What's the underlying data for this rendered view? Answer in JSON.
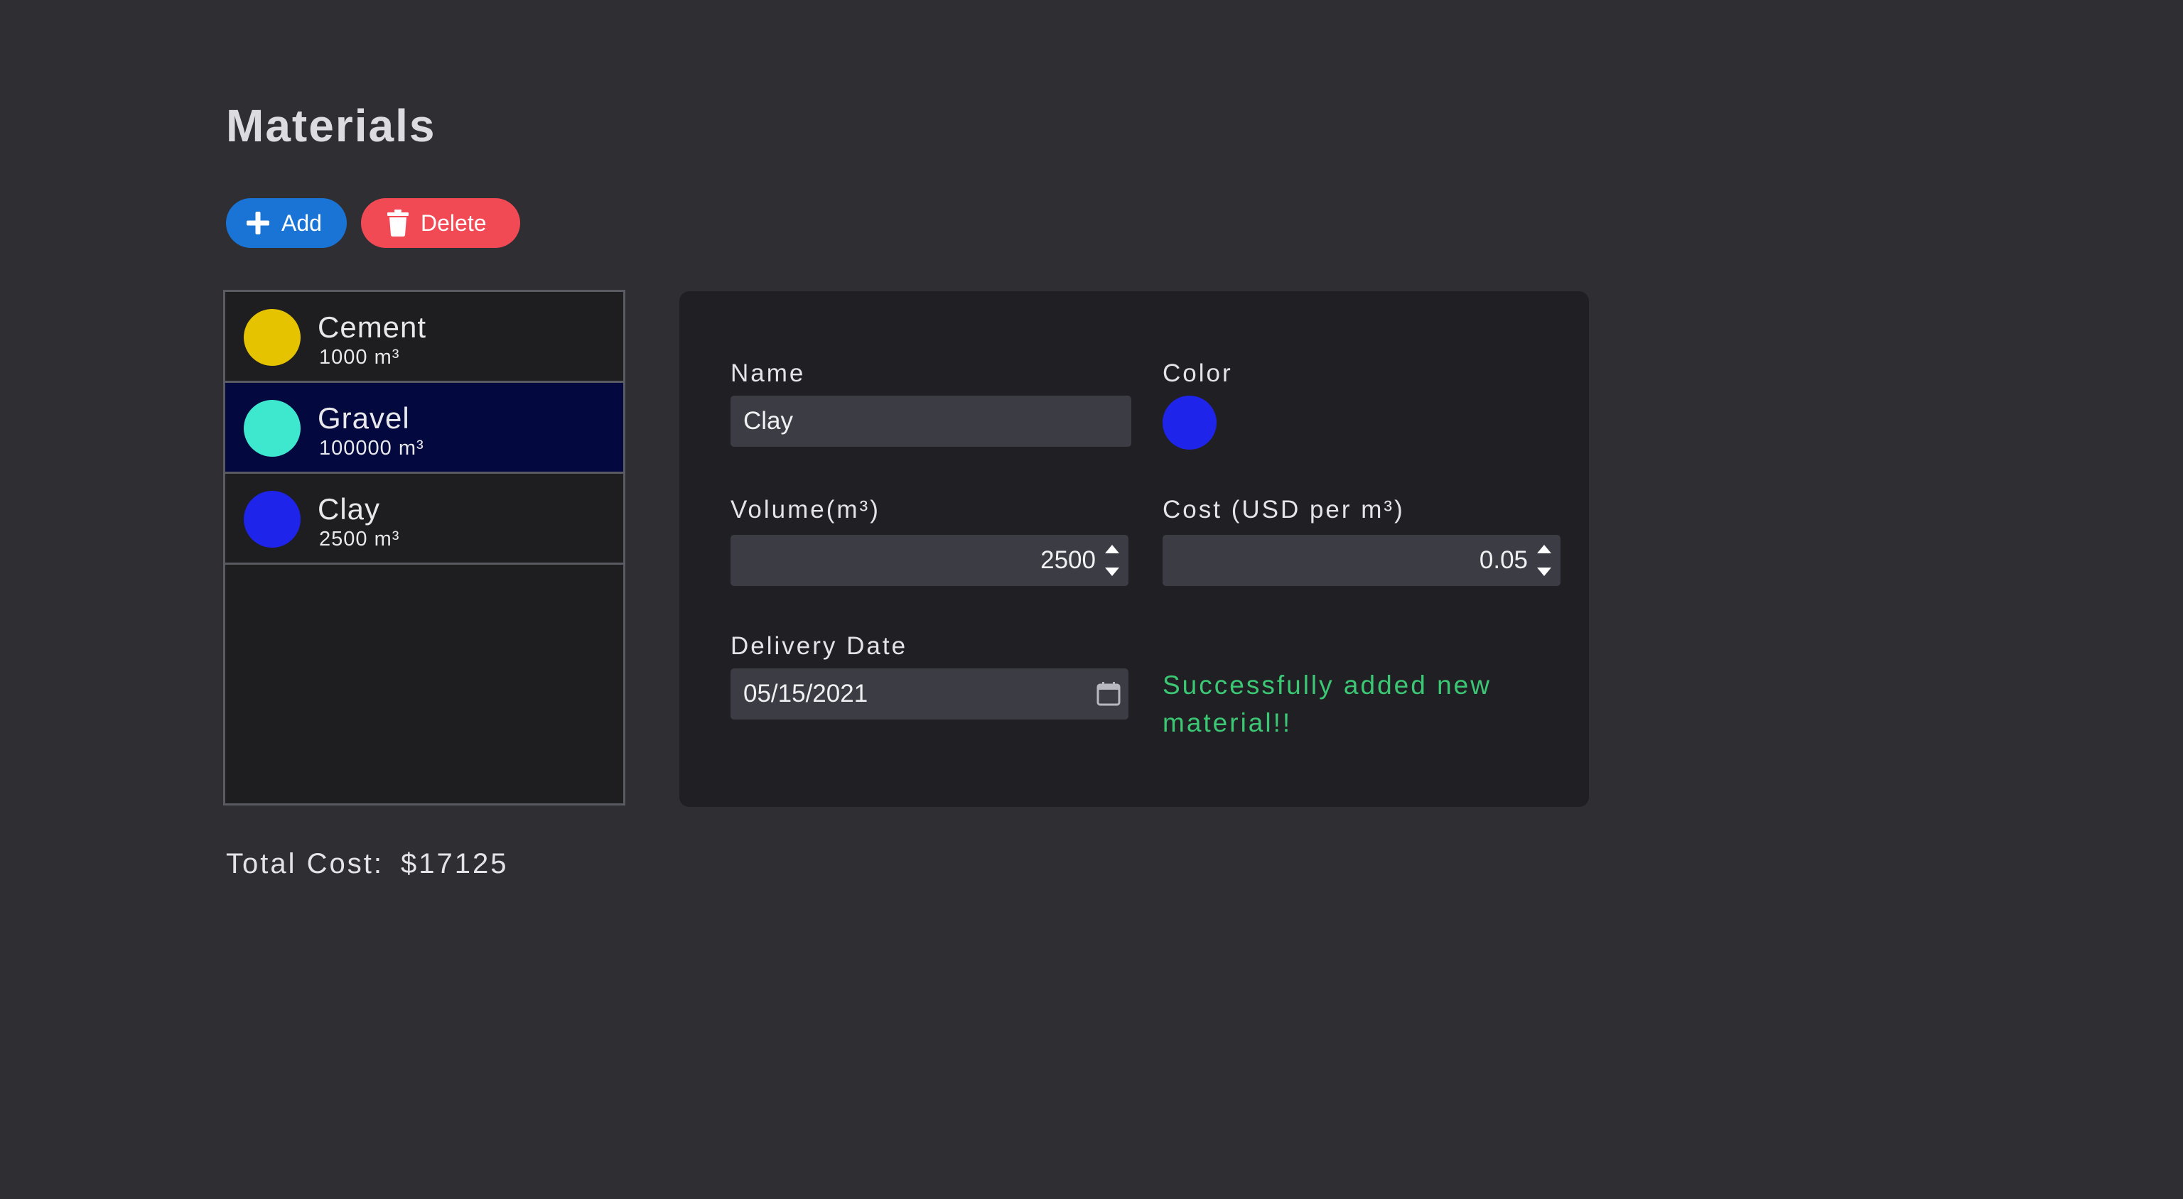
{
  "page": {
    "title": "Materials"
  },
  "toolbar": {
    "add_label": "Add",
    "delete_label": "Delete"
  },
  "materials": [
    {
      "name": "Cement",
      "volume": "1000 m³",
      "color": "#e5c300",
      "selected": false
    },
    {
      "name": "Gravel",
      "volume": "100000 m³",
      "color": "#3de8cf",
      "selected": true
    },
    {
      "name": "Clay",
      "volume": "2500 m³",
      "color": "#1f24eb",
      "selected": false
    }
  ],
  "form": {
    "name_label": "Name",
    "name_value": "Clay",
    "color_label": "Color",
    "color_value": "#1f24eb",
    "volume_label": "Volume(m³)",
    "volume_value": "2500",
    "cost_label": "Cost (USD per m³)",
    "cost_value": "0.05",
    "date_label": "Delivery Date",
    "date_value": "05/15/2021",
    "message": "Successfully added new material!!"
  },
  "footer": {
    "total_label": "Total Cost:",
    "total_value": "$17125"
  },
  "colors": {
    "background": "#2e2e33",
    "add_button": "#1a74d6",
    "delete_button": "#f24a55",
    "selected_row": "#03083e",
    "success_text": "#3cc774"
  },
  "icons": {
    "add": "plus-icon",
    "delete": "trash-icon",
    "date": "calendar-icon"
  }
}
